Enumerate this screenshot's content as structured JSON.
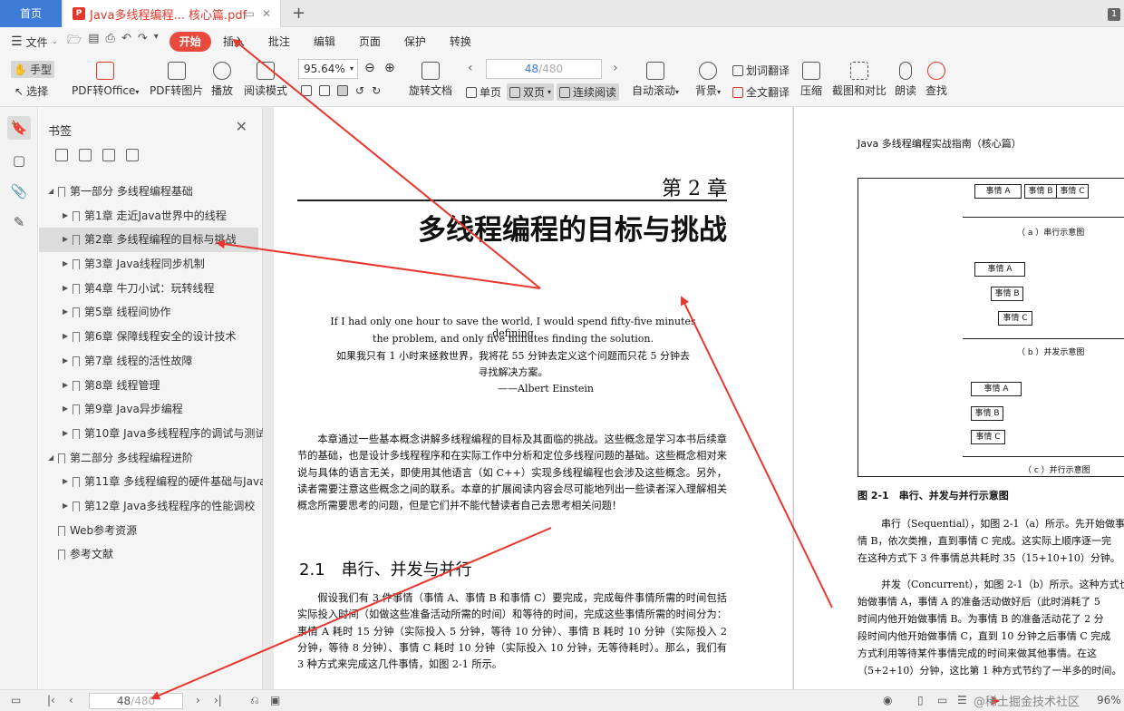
{
  "tabs": {
    "home": "首页",
    "document": "Java多线程编程... 核心篇.pdf",
    "page_badge": "1"
  },
  "menu": {
    "file": "文件",
    "items": [
      "开始",
      "插入",
      "批注",
      "编辑",
      "页面",
      "保护",
      "转换"
    ],
    "active": "开始"
  },
  "toolbar": {
    "hand": "手型",
    "select": "选择",
    "pdf_to_office": "PDF转Office",
    "pdf_to_image": "PDF转图片",
    "play": "播放",
    "read_mode": "阅读模式",
    "zoom": "95.64%",
    "rotate": "旋转文档",
    "page_current": "48",
    "page_total": "/480",
    "single_page": "单页",
    "double_page": "双页",
    "continuous": "连续阅读",
    "auto_scroll": "自动滚动",
    "background": "背景",
    "word_translate": "划词翻译",
    "full_translate": "全文翻译",
    "compress": "压缩",
    "screenshot_compare": "截图和对比",
    "read_aloud": "朗读",
    "find": "查找"
  },
  "bookmarks": {
    "title": "书签",
    "items": [
      {
        "label": "第一部分 多线程编程基础",
        "level": 0,
        "expanded": true
      },
      {
        "label": "第1章 走近Java世界中的线程",
        "level": 1
      },
      {
        "label": "第2章 多线程编程的目标与挑战",
        "level": 1,
        "selected": true
      },
      {
        "label": "第3章 Java线程同步机制",
        "level": 1
      },
      {
        "label": "第4章 牛刀小试：玩转线程",
        "level": 1
      },
      {
        "label": "第5章 线程间协作",
        "level": 1
      },
      {
        "label": "第6章 保障线程安全的设计技术",
        "level": 1
      },
      {
        "label": "第7章 线程的活性故障",
        "level": 1
      },
      {
        "label": "第8章 线程管理",
        "level": 1
      },
      {
        "label": "第9章 Java异步编程",
        "level": 1
      },
      {
        "label": "第10章 Java多线程程序的调试与测试",
        "level": 1
      },
      {
        "label": "第二部分 多线程编程进阶",
        "level": 0,
        "expanded": true
      },
      {
        "label": "第11章 多线程编程的硬件基础与Java内存模型",
        "level": 1
      },
      {
        "label": "第12章 Java多线程程序的性能调校",
        "level": 1
      },
      {
        "label": "Web参考资源",
        "level": 0,
        "leaf": true
      },
      {
        "label": "参考文献",
        "level": 0,
        "leaf": true
      }
    ]
  },
  "page_left": {
    "chapter_no": "第 2 章",
    "chapter_title": "多线程编程的目标与挑战",
    "quote_en_1": "If I had only one hour to save the world, I would spend fifty-five minutes defining",
    "quote_en_2": "the problem, and only five minutes finding the solution.",
    "quote_zh_1": "如果我只有 1 小时来拯救世界，我将花 55 分钟去定义这个问题而只花 5 分钟去",
    "quote_zh_2": "寻找解决方案。",
    "quote_author": "——Albert Einstein",
    "intro": "本章通过一些基本概念讲解多线程编程的目标及其面临的挑战。这些概念是学习本书后续章节的基础，也是设计多线程程序和在实际工作中分析和定位多线程问题的基础。这些概念相对来说与具体的语言无关，即使用其他语言（如 C++）实现多线程编程也会涉及这些概念。另外，读者需要注意这些概念之间的联系。本章的扩展阅读内容会尽可能地列出一些读者深入理解相关概念所需要思考的问题，但是它们并不能代替读者自己去思考相关问题！",
    "section_title": "2.1　串行、并发与并行",
    "section_body": "假设我们有 3 件事情（事情 A、事情 B 和事情 C）要完成，完成每件事情所需的时间包括实际投入时间（如做这些准备活动所需的时间）和等待的时间，完成这些事情所需的时间分为：事情 A 耗时 15 分钟（实际投入 5 分钟，等待 10 分钟）、事情 B 耗时 10 分钟（实际投入 2 分钟，等待 8 分钟）、事情 C 耗时 10 分钟（实际投入 10 分钟，无等待耗时）。那么，我们有 3 种方式来完成这几件事情，如图 2-1 所示。"
  },
  "page_right": {
    "header": "Java 多线程编程实战指南（核心篇）",
    "event_a": "事情 A",
    "event_b": "事情 B",
    "event_c": "事情 C",
    "caption_a": "（ a ）串行示意图",
    "caption_b": "（ b ）并发示意图",
    "caption_c": "（ c ）并行示意图",
    "figure_caption": "图 2-1　串行、并发与并行示意图",
    "lines": [
      "串行（Sequential），如图 2-1（a）所示。先开始做事",
      "情 B，依次类推，直到事情 C 完成。这实际上顺序逐一完",
      "在这种方式下 3 件事情总共耗时 35（15+10+10）分钟。",
      "并发（Concurrent），如图 2-1（b）所示。这种方式也",
      "始做事情 A，事情 A 的准备活动做好后（此时消耗了 5",
      "时间内他开始做事情 B。为事情 B 的准备活动花了 2 分",
      "段时间内他开始做事情 C，直到 10 分钟之后事情 C 完成",
      "方式利用等待某件事情完成的时间来做其他事情。在这",
      "（5+2+10）分钟，这比第 1 种方式节约了一半多的时间。"
    ]
  },
  "status": {
    "page_current": "48",
    "page_total": "/480",
    "zoom": "96%",
    "watermark": "@稀土掘金技术社区"
  }
}
